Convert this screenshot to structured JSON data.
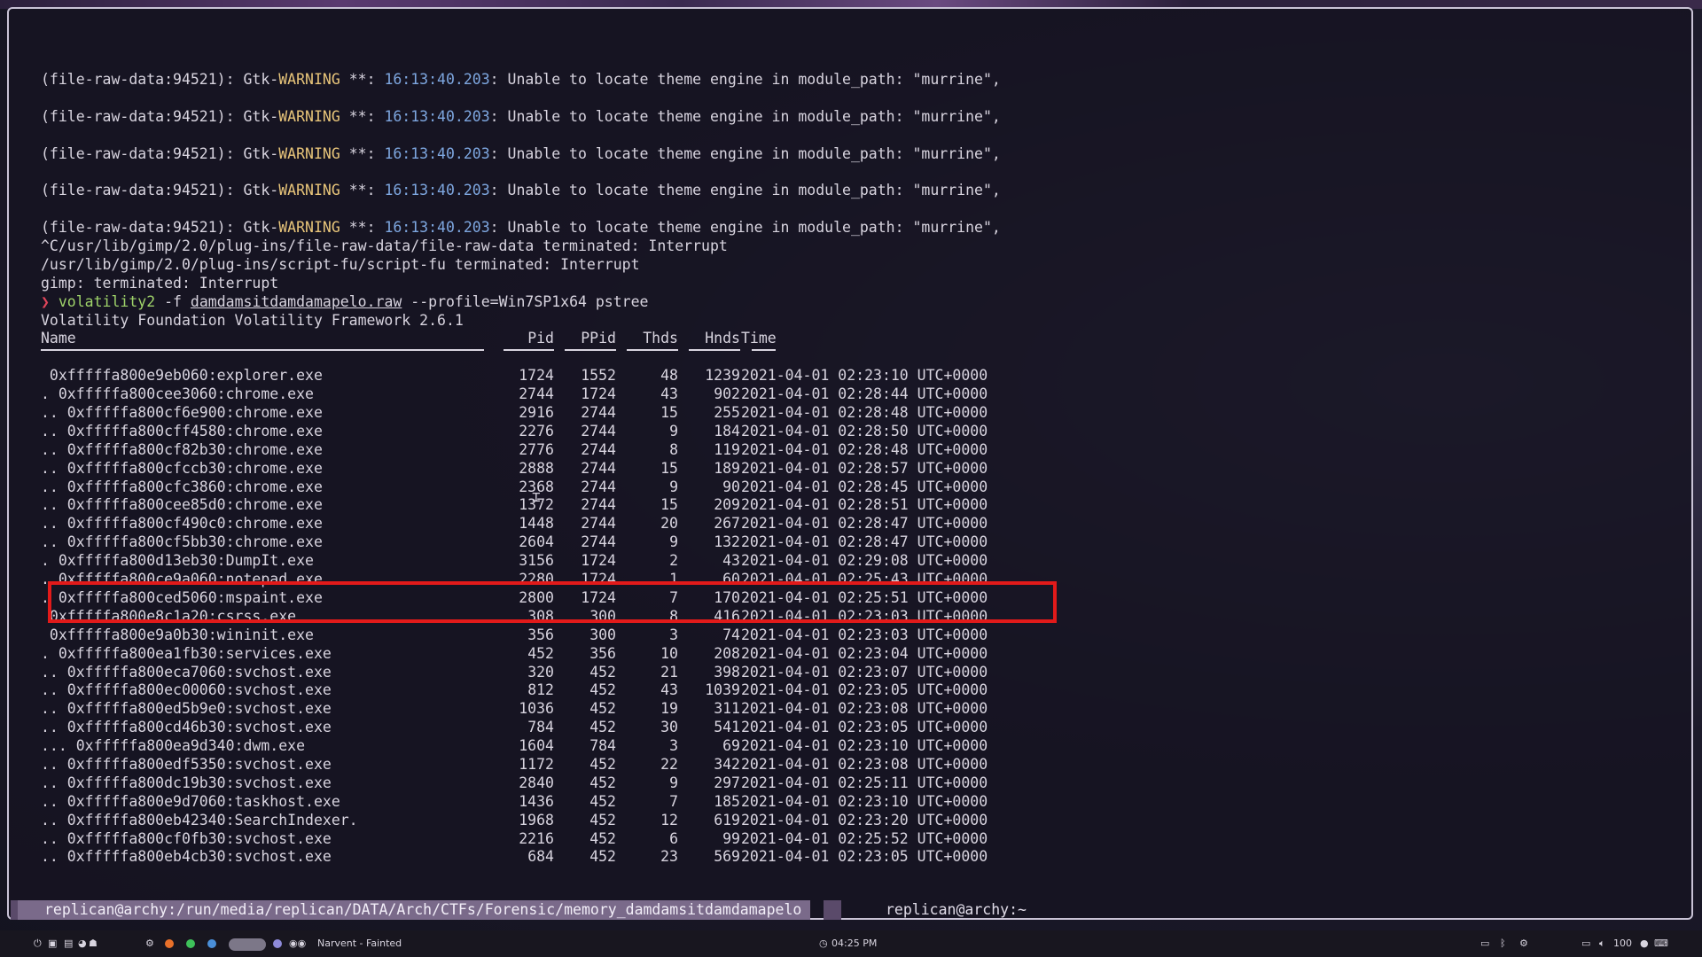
{
  "terminal": {
    "warnings": [
      {
        "prefix": "(file-raw-data:94521): Gtk-",
        "level": "WARNING",
        "mid": " **: ",
        "time": "16:13:40.203",
        "message": ": Unable to locate theme engine in module_path: \"murrine\","
      },
      {
        "prefix": "(file-raw-data:94521): Gtk-",
        "level": "WARNING",
        "mid": " **: ",
        "time": "16:13:40.203",
        "message": ": Unable to locate theme engine in module_path: \"murrine\","
      },
      {
        "prefix": "(file-raw-data:94521): Gtk-",
        "level": "WARNING",
        "mid": " **: ",
        "time": "16:13:40.203",
        "message": ": Unable to locate theme engine in module_path: \"murrine\","
      },
      {
        "prefix": "(file-raw-data:94521): Gtk-",
        "level": "WARNING",
        "mid": " **: ",
        "time": "16:13:40.203",
        "message": ": Unable to locate theme engine in module_path: \"murrine\","
      },
      {
        "prefix": "(file-raw-data:94521): Gtk-",
        "level": "WARNING",
        "mid": " **: ",
        "time": "16:13:40.203",
        "message": ": Unable to locate theme engine in module_path: \"murrine\","
      }
    ],
    "interrupt_lines": [
      "^C/usr/lib/gimp/2.0/plug-ins/file-raw-data/file-raw-data terminated: Interrupt",
      "/usr/lib/gimp/2.0/plug-ins/script-fu/script-fu terminated: Interrupt",
      "gimp: terminated: Interrupt"
    ],
    "command": {
      "arrow": "❯",
      "program": "volatility2",
      "flag": "-f",
      "file": "damdamsitdamdamapelo.raw",
      "rest": "--profile=Win7SP1x64 pstree"
    },
    "banner": "Volatility Foundation Volatility Framework 2.6.1",
    "headers": {
      "name": "Name",
      "pid": "Pid",
      "ppid": "PPid",
      "thds": "Thds",
      "hnds": "Hnds",
      "time": "Time"
    },
    "processes": [
      {
        "name": " 0xfffffa800e9eb060:explorer.exe",
        "pid": "1724",
        "ppid": "1552",
        "thds": "48",
        "hnds": "1239",
        "time": "2021-04-01 02:23:10 UTC+0000"
      },
      {
        "name": ". 0xfffffa800cee3060:chrome.exe",
        "pid": "2744",
        "ppid": "1724",
        "thds": "43",
        "hnds": "902",
        "time": "2021-04-01 02:28:44 UTC+0000"
      },
      {
        "name": ".. 0xfffffa800cf6e900:chrome.exe",
        "pid": "2916",
        "ppid": "2744",
        "thds": "15",
        "hnds": "255",
        "time": "2021-04-01 02:28:48 UTC+0000"
      },
      {
        "name": ".. 0xfffffa800cff4580:chrome.exe",
        "pid": "2276",
        "ppid": "2744",
        "thds": "9",
        "hnds": "184",
        "time": "2021-04-01 02:28:50 UTC+0000"
      },
      {
        "name": ".. 0xfffffa800cf82b30:chrome.exe",
        "pid": "2776",
        "ppid": "2744",
        "thds": "8",
        "hnds": "119",
        "time": "2021-04-01 02:28:48 UTC+0000"
      },
      {
        "name": ".. 0xfffffa800cfccb30:chrome.exe",
        "pid": "2888",
        "ppid": "2744",
        "thds": "15",
        "hnds": "189",
        "time": "2021-04-01 02:28:57 UTC+0000"
      },
      {
        "name": ".. 0xfffffa800cfc3860:chrome.exe",
        "pid": "2368",
        "ppid": "2744",
        "thds": "9",
        "hnds": "90",
        "time": "2021-04-01 02:28:45 UTC+0000"
      },
      {
        "name": ".. 0xfffffa800cee85d0:chrome.exe",
        "pid": "1372",
        "ppid": "2744",
        "thds": "15",
        "hnds": "209",
        "time": "2021-04-01 02:28:51 UTC+0000"
      },
      {
        "name": ".. 0xfffffa800cf490c0:chrome.exe",
        "pid": "1448",
        "ppid": "2744",
        "thds": "20",
        "hnds": "267",
        "time": "2021-04-01 02:28:47 UTC+0000"
      },
      {
        "name": ".. 0xfffffa800cf5bb30:chrome.exe",
        "pid": "2604",
        "ppid": "2744",
        "thds": "9",
        "hnds": "132",
        "time": "2021-04-01 02:28:47 UTC+0000"
      },
      {
        "name": ". 0xfffffa800d13eb30:DumpIt.exe",
        "pid": "3156",
        "ppid": "1724",
        "thds": "2",
        "hnds": "43",
        "time": "2021-04-01 02:29:08 UTC+0000"
      },
      {
        "name": ". 0xfffffa800ce9a060:notepad.exe",
        "pid": "2280",
        "ppid": "1724",
        "thds": "1",
        "hnds": "60",
        "time": "2021-04-01 02:25:43 UTC+0000"
      },
      {
        "name": ". 0xfffffa800ced5060:mspaint.exe",
        "pid": "2800",
        "ppid": "1724",
        "thds": "7",
        "hnds": "170",
        "time": "2021-04-01 02:25:51 UTC+0000"
      },
      {
        "name": " 0xfffffa800e8c1a20:csrss.exe",
        "pid": "308",
        "ppid": "300",
        "thds": "8",
        "hnds": "416",
        "time": "2021-04-01 02:23:03 UTC+0000"
      },
      {
        "name": " 0xfffffa800e9a0b30:wininit.exe",
        "pid": "356",
        "ppid": "300",
        "thds": "3",
        "hnds": "74",
        "time": "2021-04-01 02:23:03 UTC+0000"
      },
      {
        "name": ". 0xfffffa800ea1fb30:services.exe",
        "pid": "452",
        "ppid": "356",
        "thds": "10",
        "hnds": "208",
        "time": "2021-04-01 02:23:04 UTC+0000"
      },
      {
        "name": ".. 0xfffffa800eca7060:svchost.exe",
        "pid": "320",
        "ppid": "452",
        "thds": "21",
        "hnds": "398",
        "time": "2021-04-01 02:23:07 UTC+0000"
      },
      {
        "name": ".. 0xfffffa800ec00060:svchost.exe",
        "pid": "812",
        "ppid": "452",
        "thds": "43",
        "hnds": "1039",
        "time": "2021-04-01 02:23:05 UTC+0000"
      },
      {
        "name": ".. 0xfffffa800ed5b9e0:svchost.exe",
        "pid": "1036",
        "ppid": "452",
        "thds": "19",
        "hnds": "311",
        "time": "2021-04-01 02:23:08 UTC+0000"
      },
      {
        "name": ".. 0xfffffa800cd46b30:svchost.exe",
        "pid": "784",
        "ppid": "452",
        "thds": "30",
        "hnds": "541",
        "time": "2021-04-01 02:23:05 UTC+0000"
      },
      {
        "name": "... 0xfffffa800ea9d340:dwm.exe",
        "pid": "1604",
        "ppid": "784",
        "thds": "3",
        "hnds": "69",
        "time": "2021-04-01 02:23:10 UTC+0000"
      },
      {
        "name": ".. 0xfffffa800edf5350:svchost.exe",
        "pid": "1172",
        "ppid": "452",
        "thds": "22",
        "hnds": "342",
        "time": "2021-04-01 02:23:08 UTC+0000"
      },
      {
        "name": ".. 0xfffffa800dc19b30:svchost.exe",
        "pid": "2840",
        "ppid": "452",
        "thds": "9",
        "hnds": "297",
        "time": "2021-04-01 02:25:11 UTC+0000"
      },
      {
        "name": ".. 0xfffffa800e9d7060:taskhost.exe",
        "pid": "1436",
        "ppid": "452",
        "thds": "7",
        "hnds": "185",
        "time": "2021-04-01 02:23:10 UTC+0000"
      },
      {
        "name": ".. 0xfffffa800eb42340:SearchIndexer.",
        "pid": "1968",
        "ppid": "452",
        "thds": "12",
        "hnds": "619",
        "time": "2021-04-01 02:23:20 UTC+0000"
      },
      {
        "name": ".. 0xfffffa800cf0fb30:svchost.exe",
        "pid": "2216",
        "ppid": "452",
        "thds": "6",
        "hnds": "99",
        "time": "2021-04-01 02:25:52 UTC+0000"
      },
      {
        "name": ".. 0xfffffa800eb4cb30:svchost.exe",
        "pid": "684",
        "ppid": "452",
        "thds": "23",
        "hnds": "569",
        "time": "2021-04-01 02:23:05 UTC+0000"
      }
    ]
  },
  "tmux": {
    "left_window": "replican@archy:/run/media/replican/DATA/Arch/CTFs/Forensic/memory_damdamsitdamdamapelo",
    "right_window": "replican@archy:~"
  },
  "taskbar": {
    "media": "Narvent - Fainted",
    "clock": "04:25 PM",
    "volume": "100"
  },
  "colors": {
    "warning": "#e8c57a",
    "timestamp": "#7ea7e0",
    "command": "#9fd36a",
    "prompt_arrow": "#e0455a",
    "highlight_box": "#e21a1a"
  }
}
